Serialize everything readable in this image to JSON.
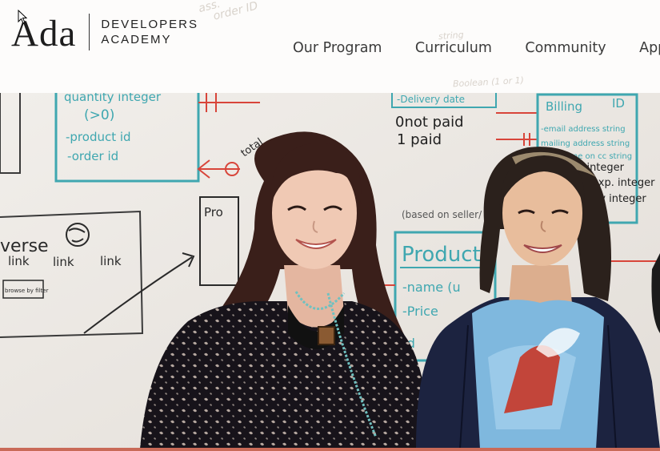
{
  "brand": {
    "logo_mark": "Ada",
    "line1": "DEVELOPERS",
    "line2": "ACADEMY"
  },
  "nav": {
    "items": [
      "Our Program",
      "Curriculum",
      "Community",
      "Appl"
    ]
  },
  "whiteboard": {
    "quantity": "quantity  integer",
    "zero": "(>0)",
    "product_id": "-product id",
    "order_id": "-order id",
    "total": "total",
    "delivery_date": "-Delivery date",
    "not_paid": "0not paid",
    "paid": "1 paid",
    "boolean": "Boolean (1 or 1)",
    "string_top": "string",
    "billing": "Billing",
    "id": "ID",
    "billing_fields": [
      "-email address string",
      "mailing address string",
      "name on cc string",
      "cc # integer",
      "exp. integer",
      "ccv integer"
    ],
    "based_on": "(based on seller/",
    "product_title": "Product",
    "product_fields": [
      "-name (u",
      "-Price",
      "-d"
    ],
    "universe": "verse",
    "links": [
      "link",
      "link",
      "link"
    ],
    "browse": "browse by filter",
    "pro": "Pro",
    "header_scribble": [
      "ass.",
      "order ID"
    ]
  },
  "colors": {
    "accent": "#c96a58",
    "teal_marker": "#3fa7b0",
    "red_marker": "#d8453a",
    "text": "#3b3b3b"
  }
}
